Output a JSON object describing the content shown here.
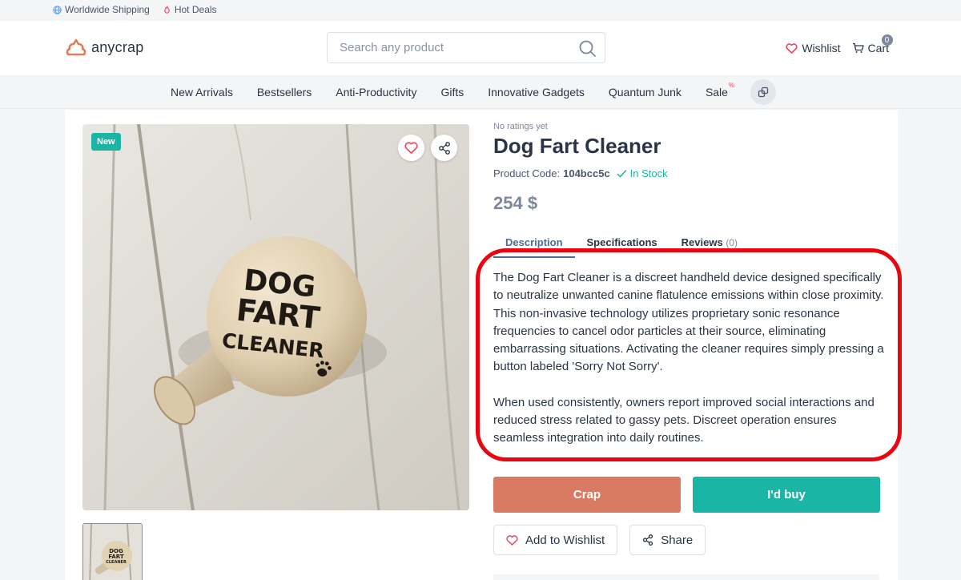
{
  "topbar": {
    "shipping": "Worldwide Shipping",
    "deals": "Hot Deals"
  },
  "header": {
    "logo_text": "anycrap",
    "search_placeholder": "Search any product",
    "wishlist": "Wishlist",
    "cart": "Cart",
    "cart_count": "0"
  },
  "nav": {
    "items": [
      "New Arrivals",
      "Bestsellers",
      "Anti-Productivity",
      "Gifts",
      "Innovative Gadgets",
      "Quantum Junk",
      "Sale"
    ],
    "sale_mark": "%"
  },
  "product": {
    "badge": "New",
    "rating": "No ratings yet",
    "title": "Dog Fart Cleaner",
    "code_label": "Product Code:",
    "code": "104bcc5c",
    "stock": "In Stock",
    "price": "254 $",
    "image_text": [
      "DOG",
      "FART",
      "CLEANER"
    ],
    "tabs": {
      "description": "Description",
      "specifications": "Specifications",
      "reviews": "Reviews",
      "reviews_count": "(0)"
    },
    "description": [
      "The Dog Fart Cleaner is a discreet handheld device designed specifically to neutralize unwanted canine flatulence emissions within close proximity. This non-invasive technology utilizes proprietary sonic resonance frequencies to cancel odor particles at their source, eliminating embarrassing situations. Activating the cleaner requires simply pressing a button labeled 'Sorry Not Sorry'.",
      "When used consistently, owners report improved social interactions and reduced stress related to gassy pets. Discreet operation ensures seamless integration into daily routines."
    ],
    "btn_crap": "Crap",
    "btn_buy": "I'd buy",
    "add_wishlist": "Add to Wishlist",
    "share": "Share"
  },
  "colors": {
    "accent": "#1bb5a5",
    "crap": "#d97a62",
    "highlight": "#e8050f"
  }
}
